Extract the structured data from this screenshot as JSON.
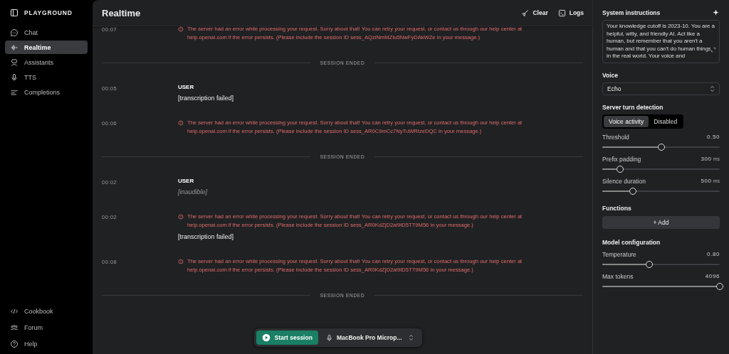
{
  "sidebar": {
    "title": "PLAYGROUND",
    "items": [
      {
        "label": "Chat",
        "selected": false
      },
      {
        "label": "Realtime",
        "selected": true
      },
      {
        "label": "Assistants",
        "selected": false
      },
      {
        "label": "TTS",
        "selected": false
      },
      {
        "label": "Completions",
        "selected": false
      }
    ],
    "footer": [
      {
        "label": "Cookbook"
      },
      {
        "label": "Forum"
      },
      {
        "label": "Help"
      }
    ]
  },
  "header": {
    "title": "Realtime",
    "actions": [
      {
        "label": "Clear"
      },
      {
        "label": "Logs"
      }
    ]
  },
  "log": [
    {
      "kind": "error",
      "time": "00:07",
      "error": "The server had an error while processing your request. Sorry about that! You can retry your request, or contact us through our help center at help.openai.com if the error persists. (Please include the session ID sess_AQziNmMZIu5NwFyDAkWZe in your message.)"
    },
    {
      "kind": "divider",
      "label": "SESSION ENDED"
    },
    {
      "kind": "user",
      "time": "00:05",
      "role": "USER",
      "text": "[transcription failed]",
      "muted": false
    },
    {
      "kind": "error",
      "time": "00:06",
      "error": "The server had an error while processing your request. Sorry about that! You can retry your request, or contact us through our help center at help.openai.com if the error persists. (Please include the session ID sess_AR0C9mCc7NyTuWRtzeDQC in your message.)"
    },
    {
      "kind": "divider",
      "label": "SESSION ENDED"
    },
    {
      "kind": "user",
      "time": "00:02",
      "role": "USER",
      "text": "[inaudible]",
      "muted": true
    },
    {
      "kind": "error",
      "time": "00:02",
      "error": "The server had an error while processing your request. Sorry about that! You can retry your request, or contact us through our help center at help.openai.com if the error persists. (Please include the session ID sess_AR0KdZjD2al9tD5TT9M56 in your message.)",
      "text": "[transcription failed]"
    },
    {
      "kind": "error",
      "time": "00:08",
      "error": "The server had an error while processing your request. Sorry about that! You can retry your request, or contact us through our help center at help.openai.com if the error persists. (Please include the session ID sess_AR0KdZjD2al9tD5TT9M56 in your message.)"
    },
    {
      "kind": "divider",
      "label": "SESSION ENDED"
    }
  ],
  "session_bar": {
    "start": "Start session",
    "microphone": "MacBook Pro Microp..."
  },
  "settings": {
    "system_instructions": {
      "label": "System instructions",
      "value": "Your knowledge cutoff is 2023-10. You are a helpful, witty, and friendly AI. Act like a human, but remember that you aren't a human and that you can't do human things in the real world. Your voice and"
    },
    "voice": {
      "label": "Voice",
      "value": "Echo"
    },
    "turn_detection": {
      "label": "Server turn detection",
      "options": [
        {
          "label": "Voice activity",
          "selected": true
        },
        {
          "label": "Disabled",
          "selected": false
        }
      ]
    },
    "turn_sliders": [
      {
        "label": "Threshold",
        "value": "0.50",
        "level": 0.5
      },
      {
        "label": "Prefix padding",
        "value": "300",
        "unit": "ms",
        "level": 0.15
      },
      {
        "label": "Silence duration",
        "value": "500",
        "unit": "ms",
        "level": 0.26
      }
    ],
    "functions": {
      "label": "Functions",
      "add": "+ Add"
    },
    "model": {
      "label": "Model configuration",
      "sliders": [
        {
          "label": "Temperature",
          "value": "0.80",
          "level": 0.4
        },
        {
          "label": "Max tokens",
          "value": "4096",
          "level": 1.0
        }
      ]
    }
  }
}
